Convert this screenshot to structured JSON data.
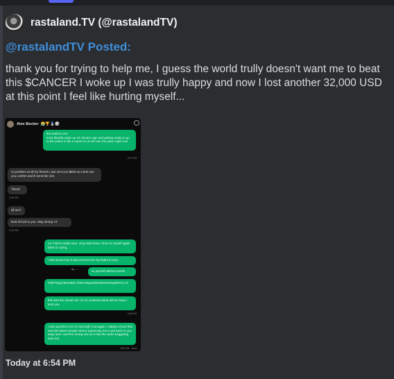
{
  "embed": {
    "author": "rastaland.TV (@rastalandTV)",
    "title": "@rastalandTV Posted:",
    "description": "thank you for trying to help me, I guess the world trully doesn't want me to beat this $CANCER I woke up I was trully happy and now I lost another 32,000 USD at this point I feel like hurting myself...",
    "footer": "Today at 6:54 PM",
    "accent_color": "#3e8edb"
  },
  "screenshot": {
    "contact_name": "Alex Becker",
    "contact_emoji": "😭🏆🥈🎲",
    "messages": [
      {
        "dir": "out",
        "text": "the world to me.\nsorry literally woke up 15 minutes ago and getting ready to go to the police to file a report so im all over the place right now."
      },
      {
        "dir": "ts",
        "text": "3:37 PM"
      },
      {
        "dir": "in",
        "text": "no problem at all my friends I just sent you $500 as a test can you confirm and ill send the rest"
      },
      {
        "dir": "in",
        "text": "*friend"
      },
      {
        "dir": "ts",
        "text": "3:38 PM"
      },
      {
        "dir": "in",
        "text": "all sent"
      },
      {
        "dir": "in",
        "text": "best of luck to you. Stay strong <3"
      },
      {
        "dir": "ts",
        "text": "3:43 PM"
      },
      {
        "dir": "out",
        "text": "no i had to make sure, omg what have i done to myself again back to crying."
      },
      {
        "dir": "out",
        "text": "i dont know how it was incorrect its my fault im sorry."
      },
      {
        "dir": "out",
        "text": "im just left without words."
      },
      {
        "dir": "out",
        "text": "FrjbFTaqqY9U6SkZL7DEXz3ayXuhtHZtUSHFwqdWTA4 cd"
      },
      {
        "dir": "out",
        "text": "this was the actual one. im so confused what adress have i sent you"
      },
      {
        "dir": "ts",
        "text": "3:48 PM"
      },
      {
        "dir": "out",
        "text": "i was spoofed or im so lost right now again, i always check first and last letters people where spamming me to get back to you asap and i sent the wrong one as it has the same beggining and end."
      },
      {
        "dir": "ts",
        "text": "3:55 PM · Sent"
      }
    ]
  }
}
